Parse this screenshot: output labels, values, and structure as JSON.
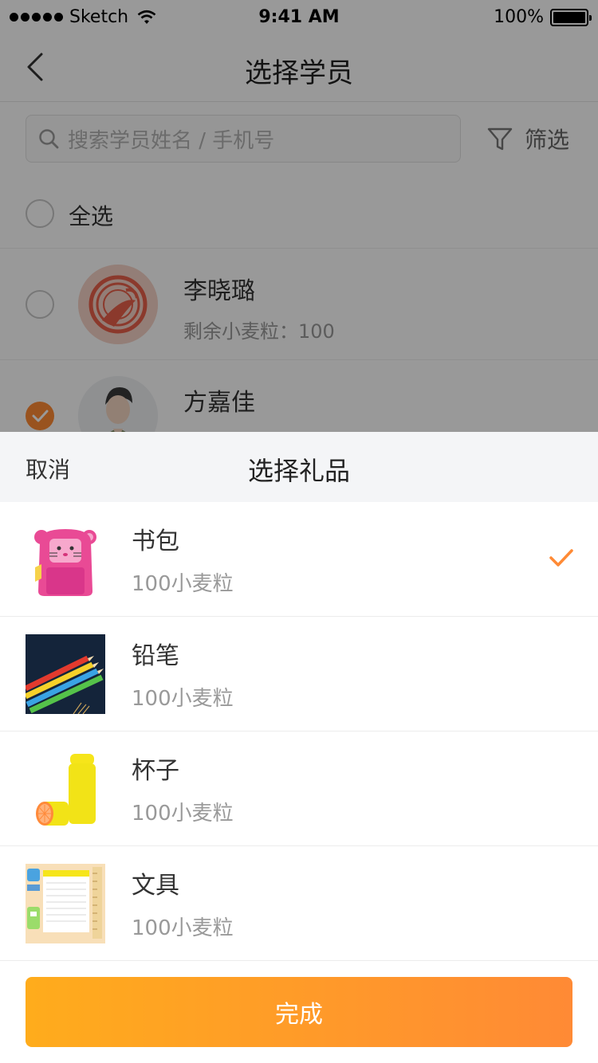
{
  "status_bar": {
    "carrier": "Sketch",
    "time": "9:41 AM",
    "battery": "100%",
    "battery_level": 1.0
  },
  "nav": {
    "title": "选择学员"
  },
  "search": {
    "placeholder": "搜索学员姓名 / 手机号",
    "filter_label": "筛选"
  },
  "select_all": {
    "label": "全选",
    "checked": false
  },
  "students": [
    {
      "name": "李晓璐",
      "remaining": "剩余小麦粒：100",
      "checked": false
    },
    {
      "name": "方嘉佳",
      "checked": true
    }
  ],
  "sheet": {
    "cancel_label": "取消",
    "title": "选择礼品",
    "gifts": [
      {
        "name": "书包",
        "price": "100小麦粒",
        "icon": "backpack-image",
        "selected": true
      },
      {
        "name": "铅笔",
        "price": "100小麦粒",
        "icon": "pencils-image",
        "selected": false
      },
      {
        "name": "杯子",
        "price": "100小麦粒",
        "icon": "cup-image",
        "selected": false
      },
      {
        "name": "文具",
        "price": "100小麦粒",
        "icon": "stationery-image",
        "selected": false
      }
    ],
    "done_label": "完成"
  },
  "colors": {
    "accent": "#ff8a35",
    "accent_start": "#ffac1c"
  }
}
